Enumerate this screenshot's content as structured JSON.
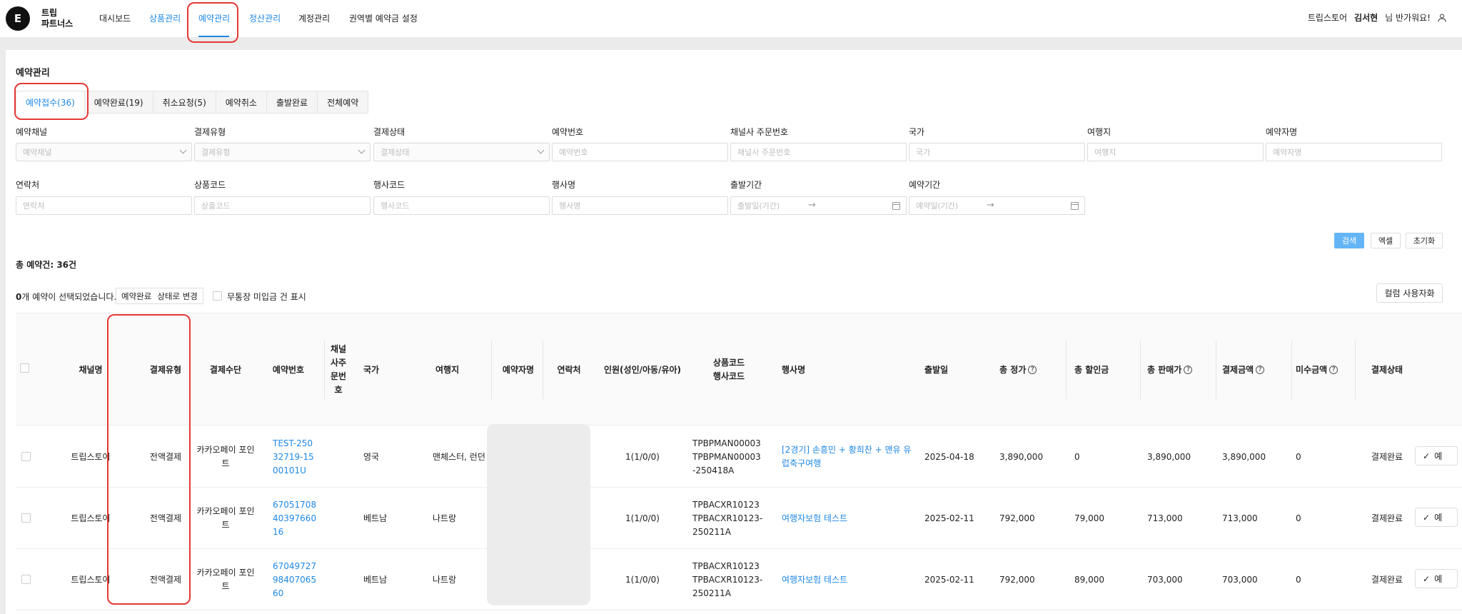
{
  "logo": {
    "letter": "E",
    "line1": "트립",
    "line2": "파트너스"
  },
  "nav": {
    "items": [
      "대시보드",
      "상품관리",
      "예약관리",
      "정산관리",
      "계정관리",
      "권역별 예약금 설정"
    ],
    "store": "트립스토어",
    "user_name": "김서현",
    "greeting": "님 반가워요!"
  },
  "page": {
    "title": "예약관리"
  },
  "tabs": [
    "예약접수(36)",
    "예약완료(19)",
    "취소요청(5)",
    "예약취소",
    "출발완료",
    "전체예약"
  ],
  "filters": {
    "row1": [
      {
        "label": "예약채널",
        "placeholder": "예약채널"
      },
      {
        "label": "결제유형",
        "placeholder": "결제유형"
      },
      {
        "label": "결제상태",
        "placeholder": "결제상태"
      },
      {
        "label": "예약번호",
        "placeholder": "예약번호"
      },
      {
        "label": "채널사 주문번호",
        "placeholder": "채널사 주문번호"
      },
      {
        "label": "국가",
        "placeholder": "국가"
      },
      {
        "label": "여행지",
        "placeholder": "여행지"
      },
      {
        "label": "예약자명",
        "placeholder": "예약자명"
      }
    ],
    "row2": [
      {
        "label": "연락처",
        "placeholder": "연락처"
      },
      {
        "label": "상품코드",
        "placeholder": "상품코드"
      },
      {
        "label": "행사코드",
        "placeholder": "행사코드"
      },
      {
        "label": "행사명",
        "placeholder": "행사명"
      },
      {
        "label": "출발기간",
        "placeholder": "출발일(기간)"
      },
      {
        "label": "예약기간",
        "placeholder": "예약일(기간)"
      }
    ]
  },
  "actions": {
    "search": "검색",
    "excel": "엑셀",
    "reset": "초기화"
  },
  "summary": {
    "total": "총 예약건: 36건",
    "selected_count": "0",
    "selected_text": "개 예약이 선택되었습니다.",
    "change_status": "예약완료",
    "change_suffix": "상태로 변경",
    "unpaid_label": "무통장 미입금 건 표시",
    "column_custom": "컬럼 사용자화"
  },
  "table": {
    "headers": [
      "채널명",
      "결제유형",
      "결제수단",
      "예약번호",
      "채널사주문번호",
      "국가",
      "여행지",
      "예약자명",
      "연락처",
      "인원(성인/아동/유아)",
      "상품코드",
      "행사코드",
      "행사명",
      "출발일",
      "총 정가",
      "총 할인금",
      "총 판매가",
      "결제금액",
      "미수금액",
      "결제상태"
    ],
    "rows": [
      {
        "channel": "트립스토어",
        "pay_type": "전액결제",
        "pay_method": "카카오페이 포인트",
        "res_no": "TEST-25032719-1500101U",
        "country": "영국",
        "dest": "맨체스터, 런던",
        "pax": "1(1/0/0)",
        "code1": "TPBPMAN00003",
        "code2": "TPBPMAN00003-250418A",
        "event": "[2경기] 손흥민 + 황희찬 + 맨유 유럽축구여행",
        "depart": "2025-04-18",
        "list": "3,890,000",
        "disc": "0",
        "sale": "3,890,000",
        "paid": "3,890,000",
        "unpaid": "0",
        "status": "결제완료",
        "btn": "예"
      },
      {
        "channel": "트립스토어",
        "pay_type": "전액결제",
        "pay_method": "카카오페이 포인트",
        "res_no": "670517084039766016",
        "country": "베트남",
        "dest": "나트랑",
        "pax": "1(1/0/0)",
        "code1": "TPBACXR10123",
        "code2": "TPBACXR10123-250211A",
        "event": "여행자보험 테스트",
        "depart": "2025-02-11",
        "list": "792,000",
        "disc": "79,000",
        "sale": "713,000",
        "paid": "713,000",
        "unpaid": "0",
        "status": "결제완료",
        "btn": "예"
      },
      {
        "channel": "트립스토어",
        "pay_type": "전액결제",
        "pay_method": "카카오페이 포인트",
        "res_no": "670497279840706560",
        "country": "베트남",
        "dest": "나트랑",
        "pax": "1(1/0/0)",
        "code1": "TPBACXR10123",
        "code2": "TPBACXR10123-250211A",
        "event": "여행자보험 테스트",
        "depart": "2025-02-11",
        "list": "792,000",
        "disc": "89,000",
        "sale": "703,000",
        "paid": "703,000",
        "unpaid": "0",
        "status": "결제완료",
        "btn": "예"
      }
    ]
  },
  "colors": {
    "accent": "#1e88e5",
    "highlight": "#e53935",
    "search_btn": "#64b5f6"
  }
}
